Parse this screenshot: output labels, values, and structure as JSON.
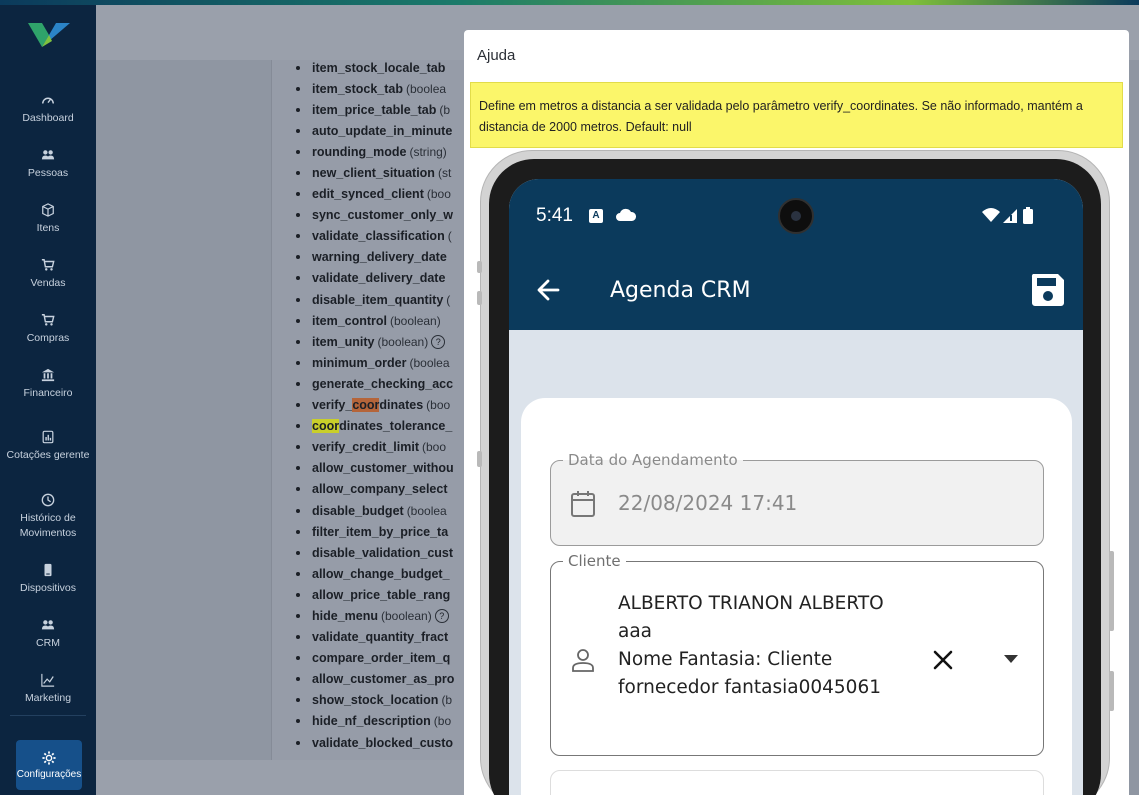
{
  "sidebar": {
    "items": [
      {
        "label": "Dashboard",
        "icon": "gauge-icon"
      },
      {
        "label": "Pessoas",
        "icon": "people-icon"
      },
      {
        "label": "Itens",
        "icon": "box-icon"
      },
      {
        "label": "Vendas",
        "icon": "cart-icon"
      },
      {
        "label": "Compras",
        "icon": "cart-icon"
      },
      {
        "label": "Financeiro",
        "icon": "bank-icon"
      },
      {
        "label": "Cotações gerente",
        "icon": "chart-doc-icon"
      },
      {
        "label": "Histórico de Movimentos",
        "icon": "clock-icon"
      },
      {
        "label": "Dispositivos",
        "icon": "phone-icon"
      },
      {
        "label": "CRM",
        "icon": "people-icon"
      },
      {
        "label": "Marketing",
        "icon": "trend-icon"
      }
    ],
    "config_label": "Configurações"
  },
  "params": [
    {
      "name": "item_stock_locale_tab",
      "type": ""
    },
    {
      "name": "item_stock_tab",
      "type": "(boolea"
    },
    {
      "name": "item_price_table_tab",
      "type": "(b"
    },
    {
      "name": "auto_update_in_minute",
      "type": ""
    },
    {
      "name": "rounding_mode",
      "type": "(string)"
    },
    {
      "name": "new_client_situation",
      "type": "(st"
    },
    {
      "name": "edit_synced_client",
      "type": "(boo"
    },
    {
      "name": "sync_customer_only_w",
      "type": ""
    },
    {
      "name": "validate_classification",
      "type": "("
    },
    {
      "name": "warning_delivery_date",
      "type": ""
    },
    {
      "name": "validate_delivery_date",
      "type": ""
    },
    {
      "name": "disable_item_quantity",
      "type": "("
    },
    {
      "name": "item_control",
      "type": "(boolean)"
    },
    {
      "name": "item_unity",
      "type": "(boolean)",
      "help": "?"
    },
    {
      "name": "minimum_order",
      "type": "(boolea"
    },
    {
      "name": "generate_checking_acc",
      "type": ""
    },
    {
      "name_pre": "verify_",
      "name_hl": "coor",
      "name_post": "dinates",
      "type": "(boo",
      "hl": "orange"
    },
    {
      "name_pre": "",
      "name_hl": "coor",
      "name_post": "dinates_tolerance_",
      "type": "",
      "hl": "yellow"
    },
    {
      "name": "verify_credit_limit",
      "type": "(boo"
    },
    {
      "name": "allow_customer_withou",
      "type": ""
    },
    {
      "name": "allow_company_select",
      "type": ""
    },
    {
      "name": "disable_budget",
      "type": "(boolea"
    },
    {
      "name": "filter_item_by_price_ta",
      "type": ""
    },
    {
      "name": "disable_validation_cust",
      "type": ""
    },
    {
      "name": "allow_change_budget_",
      "type": ""
    },
    {
      "name": "allow_price_table_rang",
      "type": ""
    },
    {
      "name": "hide_menu",
      "type": "(boolean)",
      "help": "?"
    },
    {
      "name": "validate_quantity_fract",
      "type": ""
    },
    {
      "name": "compare_order_item_q",
      "type": ""
    },
    {
      "name": "allow_customer_as_pro",
      "type": ""
    },
    {
      "name": "show_stock_location",
      "type": "(b"
    },
    {
      "name": "hide_nf_description",
      "type": "(bo"
    },
    {
      "name": "validate_blocked_custo",
      "type": ""
    }
  ],
  "modal": {
    "title": "Ajuda",
    "help_text": "Define em metros a distancia a ser validada pelo parâmetro verify_coordinates. Se não informado, mantém a distancia de 2000 metros. Default: null"
  },
  "phone": {
    "status_time": "5:41",
    "status_badge": "A",
    "app_title": "Agenda CRM",
    "date_field": {
      "label": "Data do Agendamento",
      "value": "22/08/2024 17:41"
    },
    "client_field": {
      "label": "Cliente",
      "lines": [
        "ALBERTO TRIANON ALBERTO",
        "aaa",
        "Nome Fantasia:  Cliente",
        "fornecedor fantasia0045061"
      ]
    }
  },
  "colors": {
    "sidebar_bg": "#0c2540",
    "app_bar": "#0b3a5c",
    "help_box": "#fbf66a",
    "highlight_current": "#b5653a",
    "highlight_other": "#c9cf2a"
  }
}
